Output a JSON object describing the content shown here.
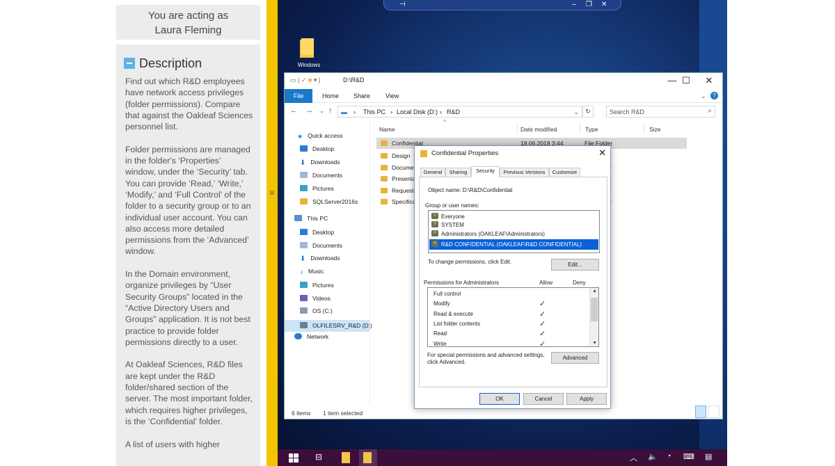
{
  "sidebar": {
    "acting_line1": "You are acting as",
    "acting_line2": "Laura Fleming",
    "description_title": "Description",
    "paragraphs": [
      "Find out which R&D employees have network access privileges (folder permissions). Compare that against the Oakleaf Sciences personnel list.",
      "Folder permissions are managed in the folder's ‘Properties’ window, under the ‘Security’ tab. You can provide ‘Read,’ ‘Write,’ ‘Modify,’ and ‘Full Control’ of the folder to a security group or to an individual user account. You can also access more detailed permissions from the ‘Advanced’ window.",
      "In the Domain environment, organize privileges by “User Security Groups” located in the “Active Directory Users and Groups” application. It is not best practice to provide folder permissions directly to a user.",
      "At Oakleaf Sciences, R&D files are kept under the R&D folder/shared section of the server. The most important folder, which requires higher privileges, is the ‘Confidential’ folder.",
      "A list of users with higher"
    ]
  },
  "desktop": {
    "folder_label": "Windows"
  },
  "explorer": {
    "title": "D:\\R&D",
    "ribbon_tabs": [
      "File",
      "Home",
      "Share",
      "View"
    ],
    "breadcrumb": [
      "This PC",
      "Local Disk (D:)",
      "R&D"
    ],
    "search_placeholder": "Search R&D",
    "nav_items": [
      {
        "label": "Quick access",
        "icon": "star-icon"
      },
      {
        "label": "Desktop",
        "icon": "desktop-icon"
      },
      {
        "label": "Downloads",
        "icon": "download-icon"
      },
      {
        "label": "Documents",
        "icon": "documents-icon"
      },
      {
        "label": "Pictures",
        "icon": "pictures-icon"
      },
      {
        "label": "SQLServer2016s",
        "icon": "folder-icon"
      },
      {
        "label": "This PC",
        "icon": "computer-icon"
      },
      {
        "label": "Desktop",
        "icon": "desktop-icon"
      },
      {
        "label": "Documents",
        "icon": "documents-icon"
      },
      {
        "label": "Downloads",
        "icon": "download-icon"
      },
      {
        "label": "Music",
        "icon": "music-icon"
      },
      {
        "label": "Pictures",
        "icon": "pictures-icon"
      },
      {
        "label": "Videos",
        "icon": "videos-icon"
      },
      {
        "label": "OS (C:)",
        "icon": "drive-icon"
      },
      {
        "label": "OLFILESRV_R&D (D:)",
        "icon": "network-drive-icon"
      },
      {
        "label": "Network",
        "icon": "network-icon"
      }
    ],
    "columns": [
      "Name",
      "Date modified",
      "Type",
      "Size"
    ],
    "files": [
      {
        "name": "Confidential",
        "date": "18.06.2018 3:44",
        "type": "File Folder"
      },
      {
        "name": "Design",
        "date": "",
        "type": "r"
      },
      {
        "name": "Documer",
        "date": "",
        "type": "r"
      },
      {
        "name": "Presentat",
        "date": "",
        "type": "r"
      },
      {
        "name": "Requests",
        "date": "",
        "type": "r"
      },
      {
        "name": "Specificat",
        "date": "",
        "type": "r"
      }
    ],
    "status_items": "6 items",
    "status_selected": "1 item selected"
  },
  "properties": {
    "title": "Confidential Properties",
    "tabs": [
      "General",
      "Sharing",
      "Security",
      "Previous Versions",
      "Customize"
    ],
    "active_tab": "Security",
    "object_name": "Object name:  D:\\R&D\\Confidential",
    "group_label": "Group or user names:",
    "groups": [
      "Everyone",
      "SYSTEM",
      "Administrators (OAKLEAF\\Administrators)",
      "R&D CONFIDENTIAL (OAKLEAF\\R&D CONFIDENTIAL)"
    ],
    "change_text": "To change permissions, click Edit.",
    "edit_button": "Edit...",
    "perm_label": "Permissions for Administrators",
    "allow_label": "Allow",
    "deny_label": "Deny",
    "permissions": [
      "Full control",
      "Modify",
      "Read & execute",
      "List folder contents",
      "Read",
      "Write"
    ],
    "checked": [
      false,
      true,
      true,
      true,
      true,
      true
    ],
    "special_line1": "For special permissions and advanced settings,",
    "special_line2": "click Advanced.",
    "advanced_button": "Advanced",
    "ok_button": "OK",
    "cancel_button": "Cancel",
    "apply_button": "Apply"
  },
  "colors": {
    "splitter": "#f5c400",
    "taskbar": "#3b0f3a",
    "file_tab": "#1979ca",
    "selection": "#0a61d8",
    "folder": "#e8b33a"
  }
}
